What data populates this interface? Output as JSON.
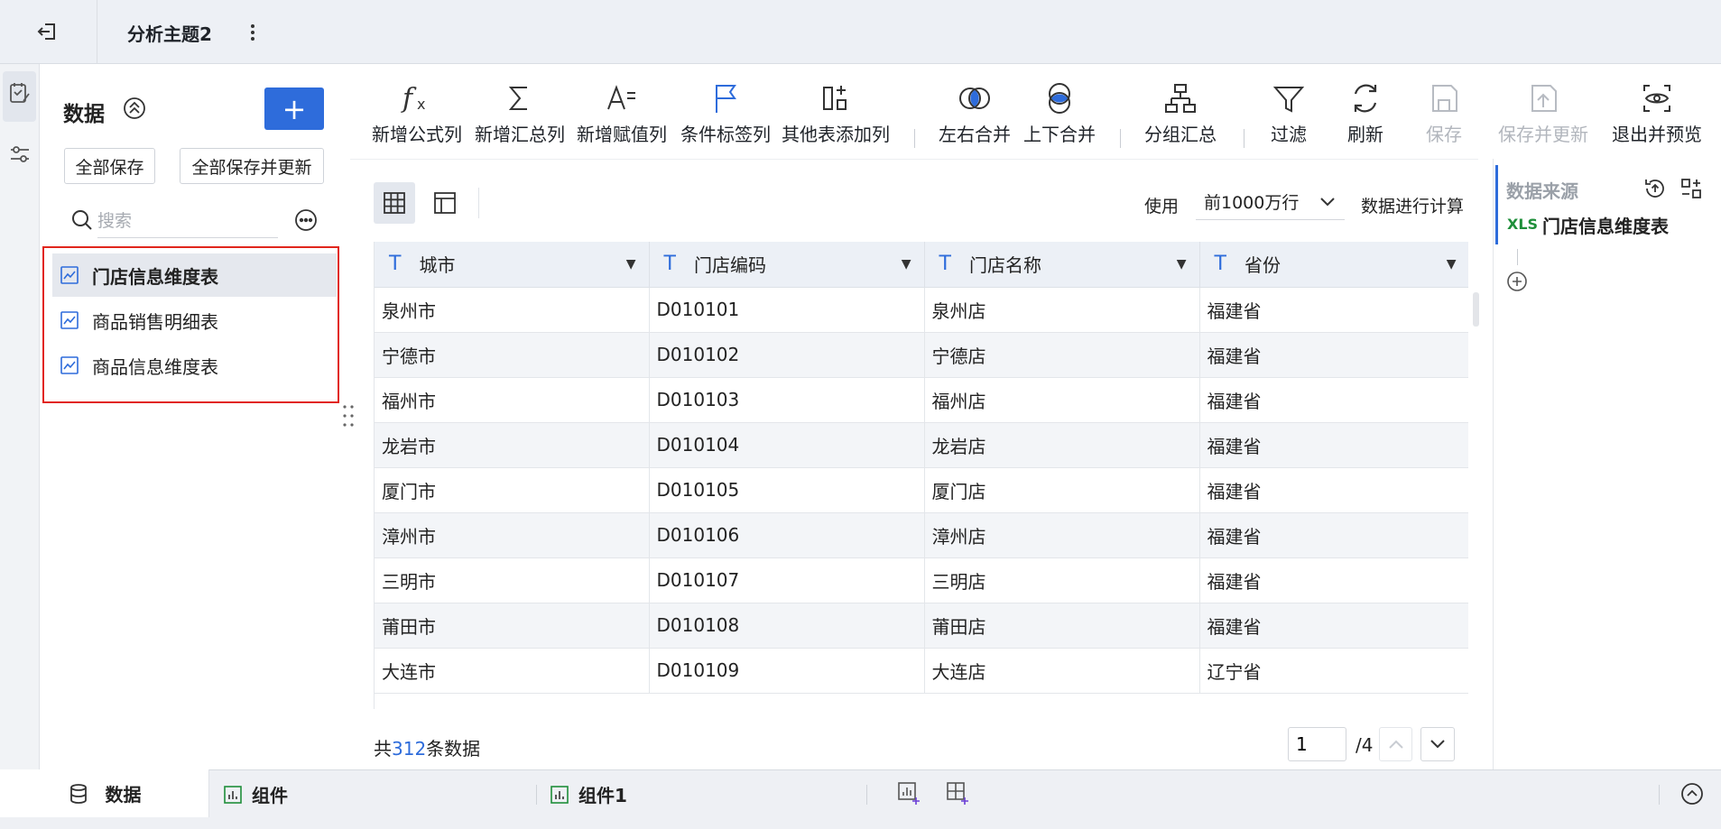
{
  "top": {
    "tab_title": "分析主题2"
  },
  "data_panel": {
    "title": "数据",
    "add_label": "+",
    "save_all": "全部保存",
    "save_all_update": "全部保存并更新",
    "search_placeholder": "搜索",
    "tables": [
      {
        "name": "门店信息维度表",
        "selected": true
      },
      {
        "name": "商品销售明细表",
        "selected": false
      },
      {
        "name": "商品信息维度表",
        "selected": false
      }
    ]
  },
  "toolbar": {
    "add_formula": "新增公式列",
    "add_summary": "新增汇总列",
    "add_assign": "新增赋值列",
    "cond_label": "条件标签列",
    "other_add": "其他表添加列",
    "lr_merge": "左右合并",
    "ud_merge": "上下合并",
    "group_summary": "分组汇总",
    "filter": "过滤",
    "refresh": "刷新",
    "save": "保存",
    "save_update": "保存并更新",
    "exit_preview": "退出并预览"
  },
  "view": {
    "use_label": "使用",
    "rows_option": "前1000万行",
    "calc_label": "数据进行计算"
  },
  "table": {
    "columns": [
      "城市",
      "门店编码",
      "门店名称",
      "省份"
    ],
    "rows": [
      [
        "泉州市",
        "D010101",
        "泉州店",
        "福建省"
      ],
      [
        "宁德市",
        "D010102",
        "宁德店",
        "福建省"
      ],
      [
        "福州市",
        "D010103",
        "福州店",
        "福建省"
      ],
      [
        "龙岩市",
        "D010104",
        "龙岩店",
        "福建省"
      ],
      [
        "厦门市",
        "D010105",
        "厦门店",
        "福建省"
      ],
      [
        "漳州市",
        "D010106",
        "漳州店",
        "福建省"
      ],
      [
        "三明市",
        "D010107",
        "三明店",
        "福建省"
      ],
      [
        "莆田市",
        "D010108",
        "莆田店",
        "福建省"
      ],
      [
        "大连市",
        "D010109",
        "大连店",
        "辽宁省"
      ]
    ]
  },
  "footer": {
    "total_prefix": "共",
    "total_count": "312",
    "total_suffix": "条数据",
    "page": "1",
    "page_total": "/4"
  },
  "source_panel": {
    "title": "数据来源",
    "xls_badge": "XLS",
    "table_name": "门店信息维度表"
  },
  "bottom": {
    "tab_data": "数据",
    "tab_component": "组件",
    "tab_component1": "组件1"
  },
  "colors": {
    "accent": "#2e6cdb",
    "highlight_border": "#e1261c"
  }
}
